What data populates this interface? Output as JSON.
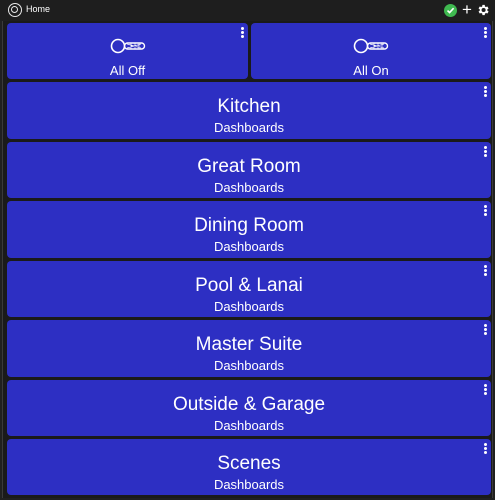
{
  "header": {
    "title": "Home",
    "icons": {
      "home": "home-icon",
      "status": "check-circle-icon",
      "add": "plus-icon",
      "settings": "gear-icon"
    },
    "status_color": "#3fb950"
  },
  "colors": {
    "tile": "#2d2fc3",
    "background": "#1a1a1a",
    "text": "#ffffff"
  },
  "switches": [
    {
      "label": "All Off",
      "icon": "toggle-switch-icon"
    },
    {
      "label": "All On",
      "icon": "toggle-switch-icon"
    }
  ],
  "rooms": [
    {
      "title": "Kitchen",
      "subtitle": "Dashboards"
    },
    {
      "title": "Great Room",
      "subtitle": "Dashboards"
    },
    {
      "title": "Dining Room",
      "subtitle": "Dashboards"
    },
    {
      "title": "Pool & Lanai",
      "subtitle": "Dashboards"
    },
    {
      "title": "Master Suite",
      "subtitle": "Dashboards"
    },
    {
      "title": "Outside & Garage",
      "subtitle": "Dashboards"
    },
    {
      "title": "Scenes",
      "subtitle": "Dashboards"
    }
  ]
}
